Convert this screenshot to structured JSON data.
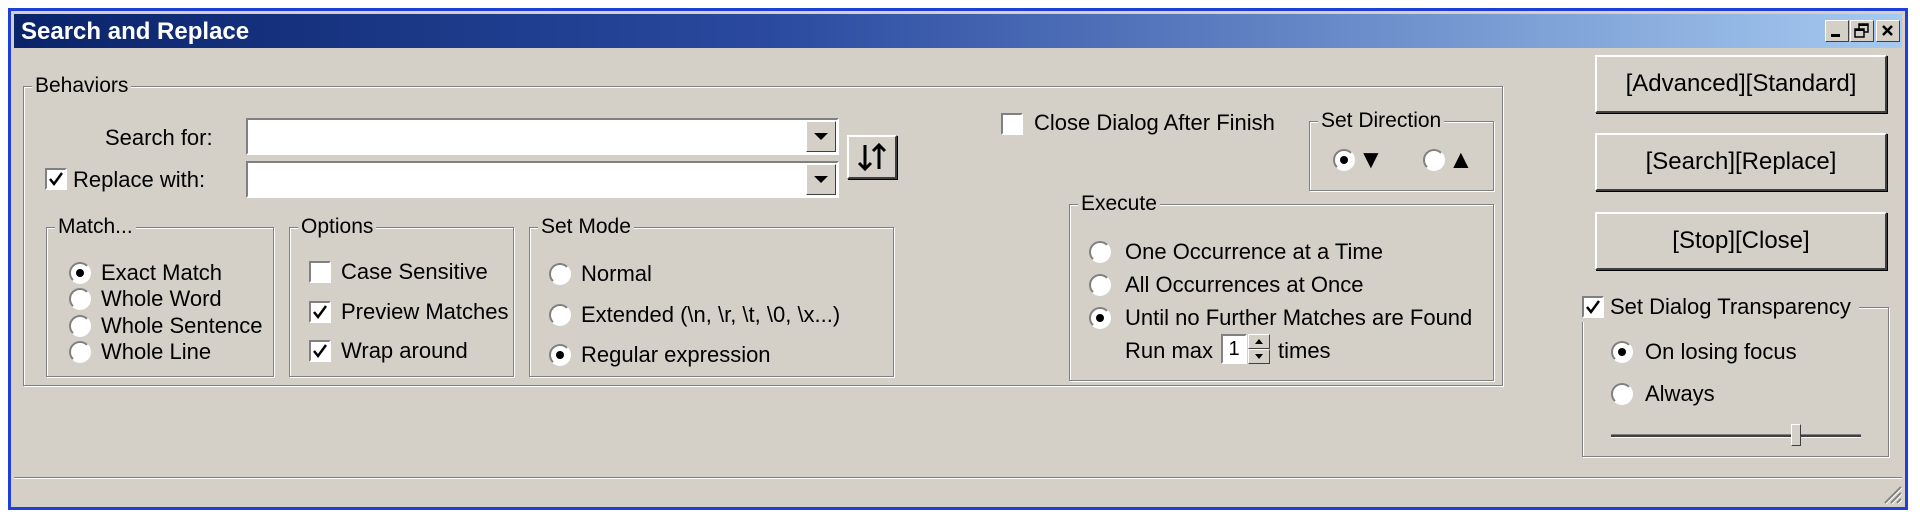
{
  "window": {
    "title": "Search and Replace"
  },
  "behaviors": {
    "legend": "Behaviors",
    "search_label": "Search for:",
    "search_value": "",
    "replace_label": "Replace with:",
    "replace_checked": true,
    "replace_value": ""
  },
  "match": {
    "legend": "Match...",
    "options": [
      "Exact Match",
      "Whole Word",
      "Whole Sentence",
      "Whole Line"
    ],
    "selected": 0
  },
  "options": {
    "legend": "Options",
    "items": [
      {
        "label": "Case Sensitive",
        "checked": false
      },
      {
        "label": "Preview Matches",
        "checked": true
      },
      {
        "label": "Wrap around",
        "checked": true
      }
    ]
  },
  "mode": {
    "legend": "Set Mode",
    "options": [
      "Normal",
      "Extended (\\n, \\r, \\t, \\0, \\x...)",
      "Regular expression"
    ],
    "selected": 2
  },
  "close_after": {
    "label": "Close Dialog After Finish",
    "checked": false
  },
  "direction": {
    "legend": "Set Direction",
    "down_symbol": "▼",
    "up_symbol": "▲",
    "selected": "down"
  },
  "execute": {
    "legend": "Execute",
    "options": [
      "One Occurrence at a Time",
      "All Occurrences at Once",
      "Until no Further Matches are Found"
    ],
    "selected": 2,
    "run_max_label": "Run max",
    "run_max_value": "1",
    "times_label": "times"
  },
  "buttons": {
    "advanced": "[Advanced][Standard]",
    "search": "[Search][Replace]",
    "stop": "[Stop][Close]"
  },
  "transparency": {
    "label": "Set Dialog Transparency",
    "checked": true,
    "options": [
      "On losing focus",
      "Always"
    ],
    "selected": 0,
    "slider_value": 0.75
  },
  "colors": {
    "title_start": "#0a246a",
    "title_end": "#a6caf0",
    "face": "#d4d0c8",
    "border": "#1f3fd8"
  }
}
